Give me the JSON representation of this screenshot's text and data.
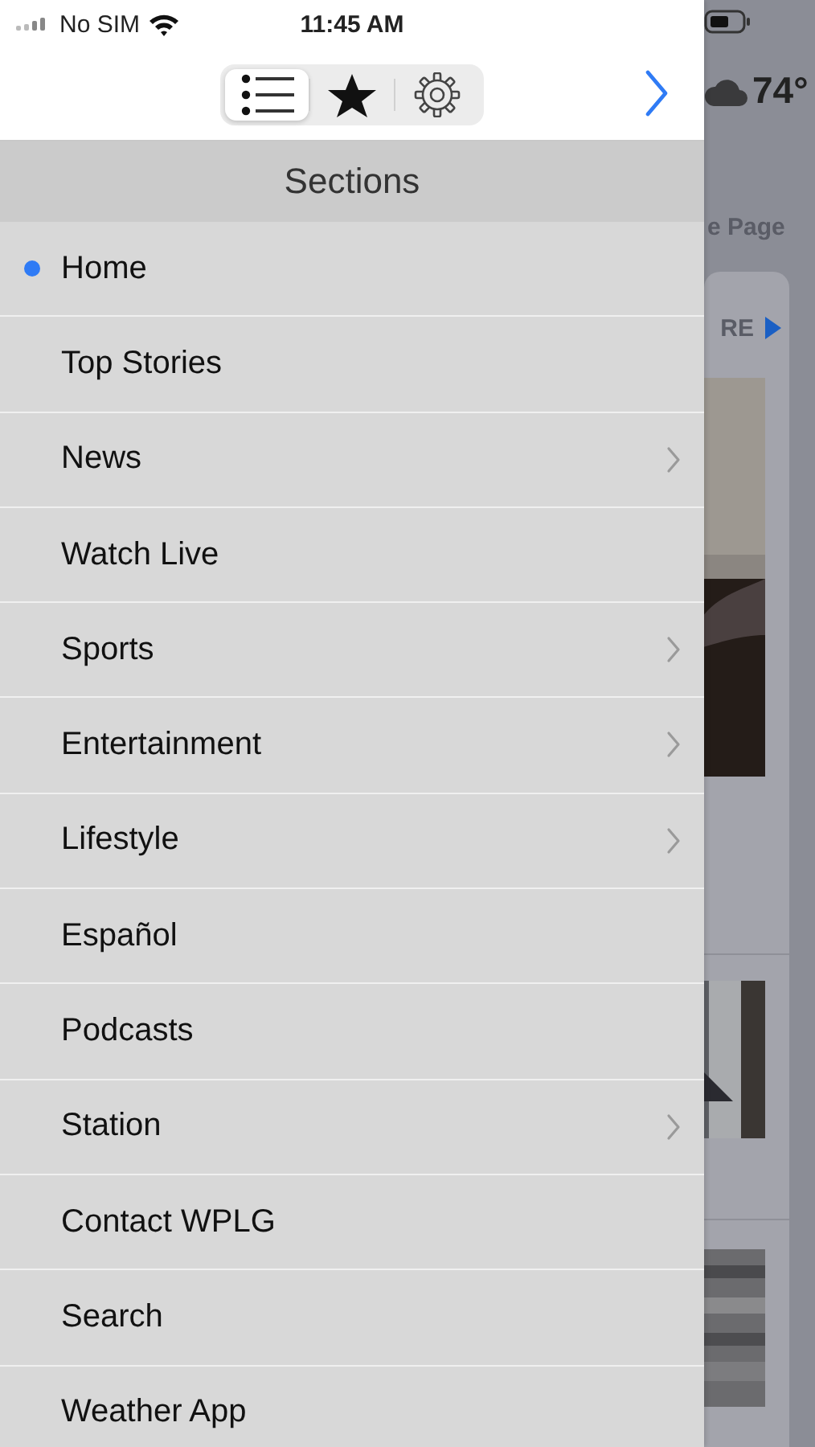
{
  "status_bar": {
    "carrier": "No SIM",
    "time": "11:45 AM"
  },
  "toolbar": {
    "segments": [
      {
        "kind": "list",
        "selected": true
      },
      {
        "kind": "star",
        "selected": false
      },
      {
        "kind": "gear",
        "selected": false
      }
    ]
  },
  "sections": {
    "title": "Sections",
    "items": [
      {
        "label": "Home",
        "selected": true,
        "has_submenu": false
      },
      {
        "label": "Top Stories",
        "selected": false,
        "has_submenu": false
      },
      {
        "label": "News",
        "selected": false,
        "has_submenu": true
      },
      {
        "label": "Watch Live",
        "selected": false,
        "has_submenu": false
      },
      {
        "label": "Sports",
        "selected": false,
        "has_submenu": true
      },
      {
        "label": "Entertainment",
        "selected": false,
        "has_submenu": true
      },
      {
        "label": "Lifestyle",
        "selected": false,
        "has_submenu": true
      },
      {
        "label": "Español",
        "selected": false,
        "has_submenu": false
      },
      {
        "label": "Podcasts",
        "selected": false,
        "has_submenu": false
      },
      {
        "label": "Station",
        "selected": false,
        "has_submenu": true
      },
      {
        "label": "Contact WPLG",
        "selected": false,
        "has_submenu": false
      },
      {
        "label": "Search",
        "selected": false,
        "has_submenu": false
      },
      {
        "label": "Weather App",
        "selected": false,
        "has_submenu": false
      }
    ]
  },
  "background_page": {
    "temperature": "74°",
    "section_title": "e Page",
    "more_label": "RE"
  }
}
